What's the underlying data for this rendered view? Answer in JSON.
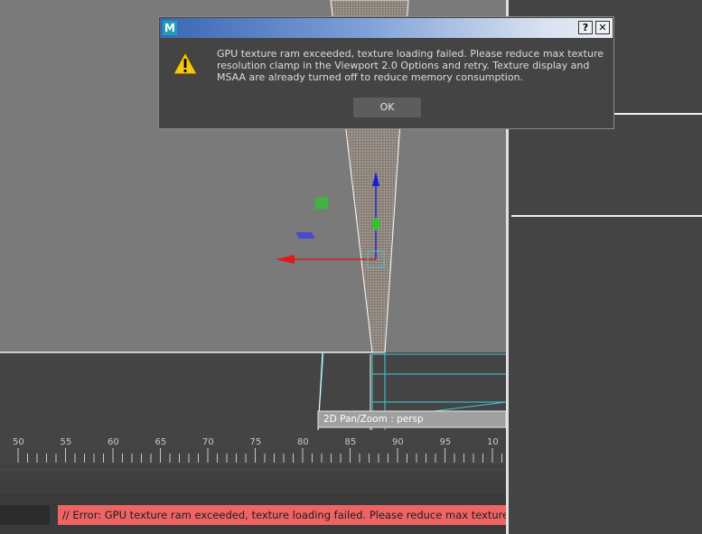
{
  "dialog": {
    "app_icon_letter": "M",
    "help_label": "?",
    "close_label": "✕",
    "message": "GPU texture ram exceeded, texture loading failed. Please reduce max texture resolution clamp in the Viewport 2.0 Options and retry. Texture display and MSAA are already turned off to reduce memory consumption.",
    "ok_label": "OK",
    "icon": "warning-icon"
  },
  "viewport": {
    "camera_label": "2D Pan/Zoom : persp"
  },
  "timeline": {
    "ticks": [
      "50",
      "55",
      "60",
      "65",
      "70",
      "75",
      "80",
      "85",
      "90",
      "95",
      "10"
    ]
  },
  "command_line": {
    "error_text": "// Error: GPU texture ram exceeded, texture loading failed. Please reduce max texture resolution"
  },
  "colors": {
    "viewport_bg": "#7a7a7a",
    "lower_viewport_bg": "#444444",
    "error_bg": "#ee6464",
    "accent_cyan": "#46c8d8",
    "titlebar_blue": "#3a66b5"
  }
}
